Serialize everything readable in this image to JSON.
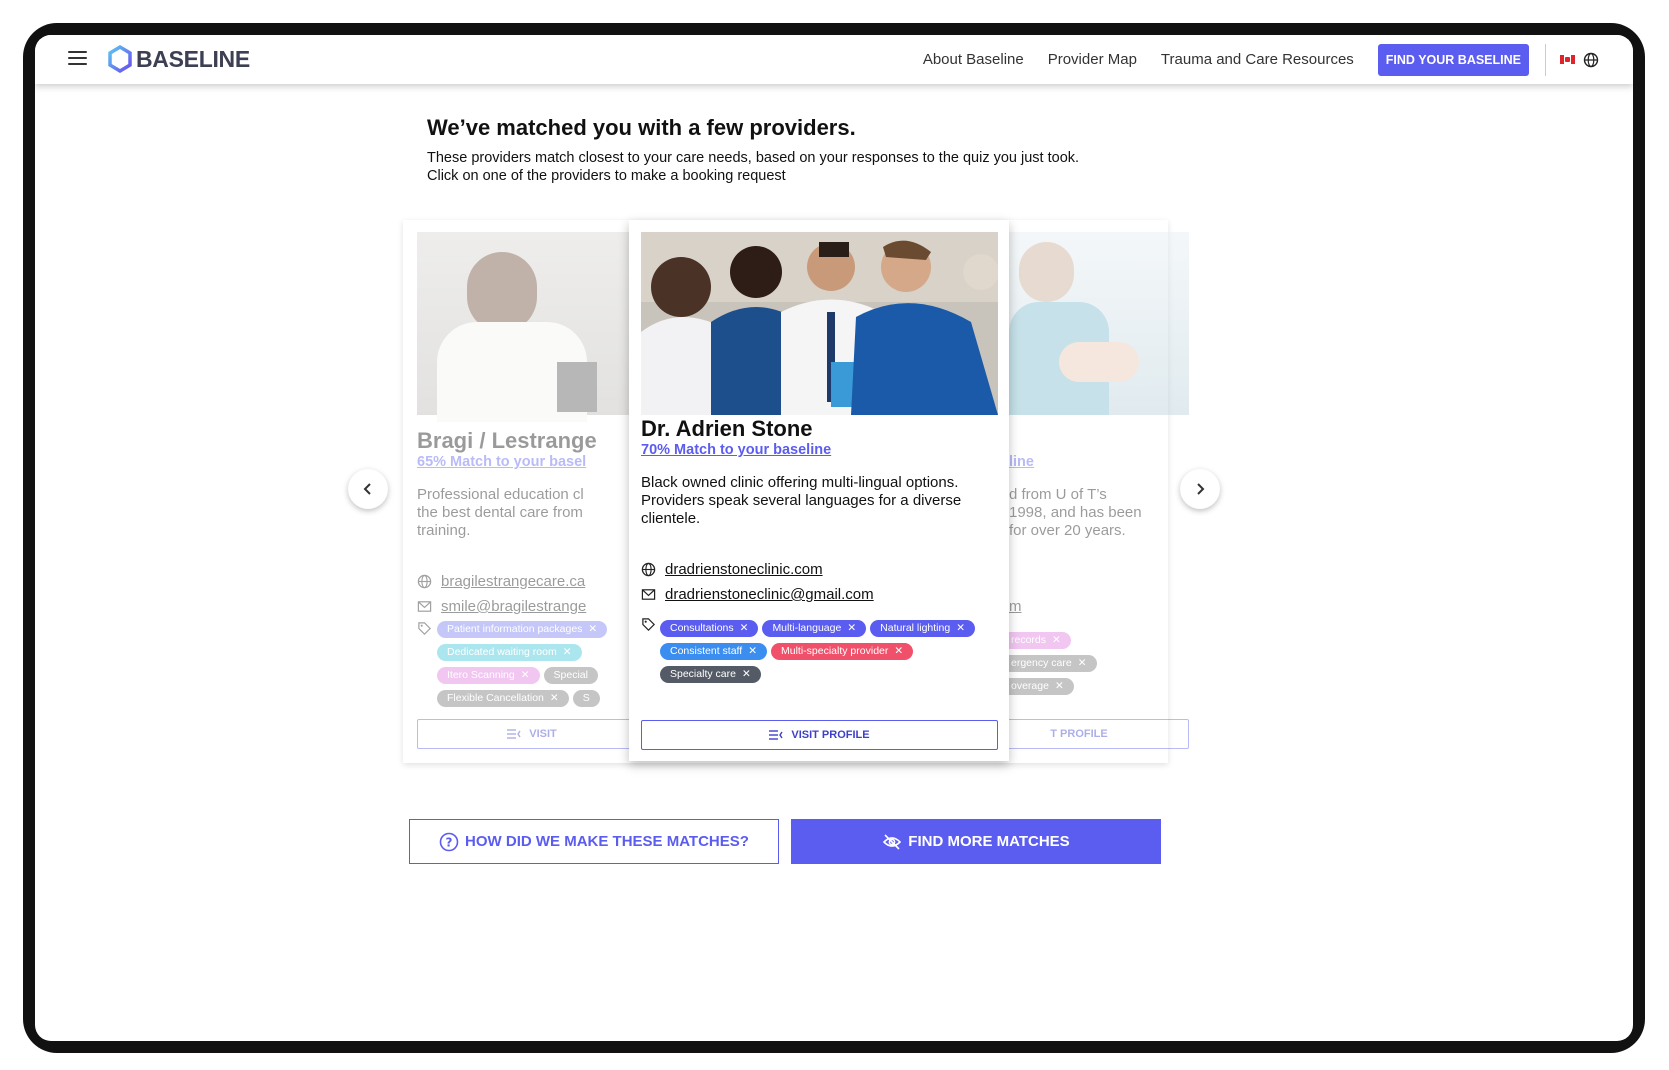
{
  "header": {
    "brand": "BASELINE",
    "nav": [
      "About Baseline",
      "Provider Map",
      "Trauma and Care Resources"
    ],
    "cta": "FIND YOUR BASELINE",
    "icons": [
      "hamburger-icon",
      "logo-icon",
      "canada-flag-icon",
      "globe-icon"
    ]
  },
  "main": {
    "title": "We’ve matched you with a few providers.",
    "subtitle_1": "These providers match closest to your care needs, based on your responses to the quiz you just took.",
    "subtitle_2": "Click on one of the providers to make a booking request"
  },
  "colors": {
    "accent": "#5b5cf0",
    "tag_blue": "#3b8ef0",
    "tag_red": "#f0506a",
    "tag_gray": "#555b66"
  },
  "providers": {
    "left": {
      "name": "Bragi / Lestrange",
      "match": "65% Match to your basel",
      "desc_1": "Professional education cl",
      "desc_2": "the best dental care from",
      "desc_3": "training.",
      "website": "bragilestrangecare.ca",
      "email": "smile@bragilestrange",
      "tags": [
        "Patient information packages",
        "Dedicated waiting room",
        "Itero Scanning",
        "Special",
        "Flexible Cancellation",
        "S"
      ],
      "visit": "VISIT"
    },
    "center": {
      "name": "Dr. Adrien Stone",
      "match": "70% Match to your baseline",
      "desc": "Black owned clinic offering multi-lingual options. Providers speak several languages for a diverse clientele.",
      "website": "dradrienstoneclinic.com",
      "email": "dradrienstoneclinic@gmail.com",
      "tags": [
        {
          "label": "Consultations",
          "color": "#5b5cf0"
        },
        {
          "label": "Multi-language",
          "color": "#5b5cf0"
        },
        {
          "label": "Natural lighting",
          "color": "#5b5cf0"
        },
        {
          "label": "Consistent staff",
          "color": "#3b8ef0"
        },
        {
          "label": "Multi-specialty provider",
          "color": "#f0506a"
        },
        {
          "label": "Specialty care",
          "color": "#555b66"
        }
      ],
      "visit": "VISIT PROFILE"
    },
    "right": {
      "match": "line",
      "desc_1": "d from U of T’s",
      "desc_2": "1998, and has been",
      "desc_3": "for over 20 years.",
      "email": "m",
      "tags": [
        "records",
        "ergency care",
        "overage"
      ],
      "visit": "T PROFILE"
    }
  },
  "buttons": {
    "how": "HOW DID WE MAKE THESE MATCHES?",
    "more": "FIND MORE MATCHES"
  }
}
